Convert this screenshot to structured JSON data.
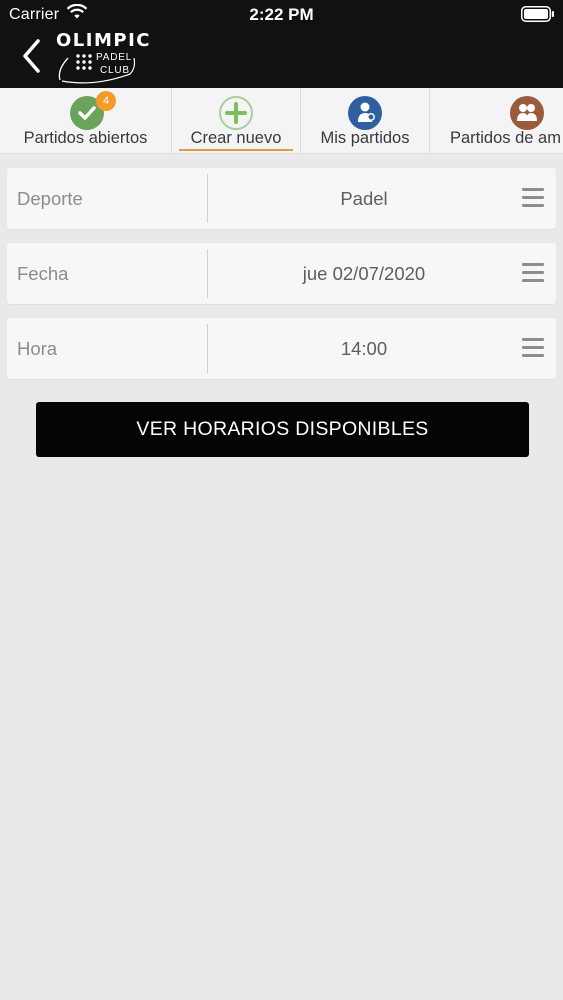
{
  "status_bar": {
    "carrier": "Carrier",
    "time": "2:22 PM",
    "wifi_icon": "wifi-icon",
    "battery_icon": "battery-icon"
  },
  "header": {
    "back_icon": "chevron-left-icon",
    "logo": {
      "brand": "OLIMPIC",
      "line1": "PADEL",
      "line2": "CLUB"
    }
  },
  "tabs": [
    {
      "label": "Partidos abiertos",
      "icon": "check-icon",
      "color": "#6aa35a",
      "badge": "4"
    },
    {
      "label": "Crear nuevo",
      "icon": "plus-icon",
      "color": "#7cc05a",
      "selected": true
    },
    {
      "label": "Mis partidos",
      "icon": "player-icon",
      "color": "#2f5f9e"
    },
    {
      "label": "Partidos de am",
      "icon": "friends-icon",
      "color": "#9a5a3c"
    }
  ],
  "form": {
    "sport": {
      "label": "Deporte",
      "value": "Padel"
    },
    "date": {
      "label": "Fecha",
      "value": "jue 02/07/2020"
    },
    "time": {
      "label": "Hora",
      "value": "14:00"
    }
  },
  "cta": {
    "label": "VER HORARIOS DISPONIBLES"
  },
  "colors": {
    "accent_underline": "#e39c3c",
    "badge": "#f29b26",
    "header_bg": "#111111",
    "button_bg": "#050505"
  }
}
